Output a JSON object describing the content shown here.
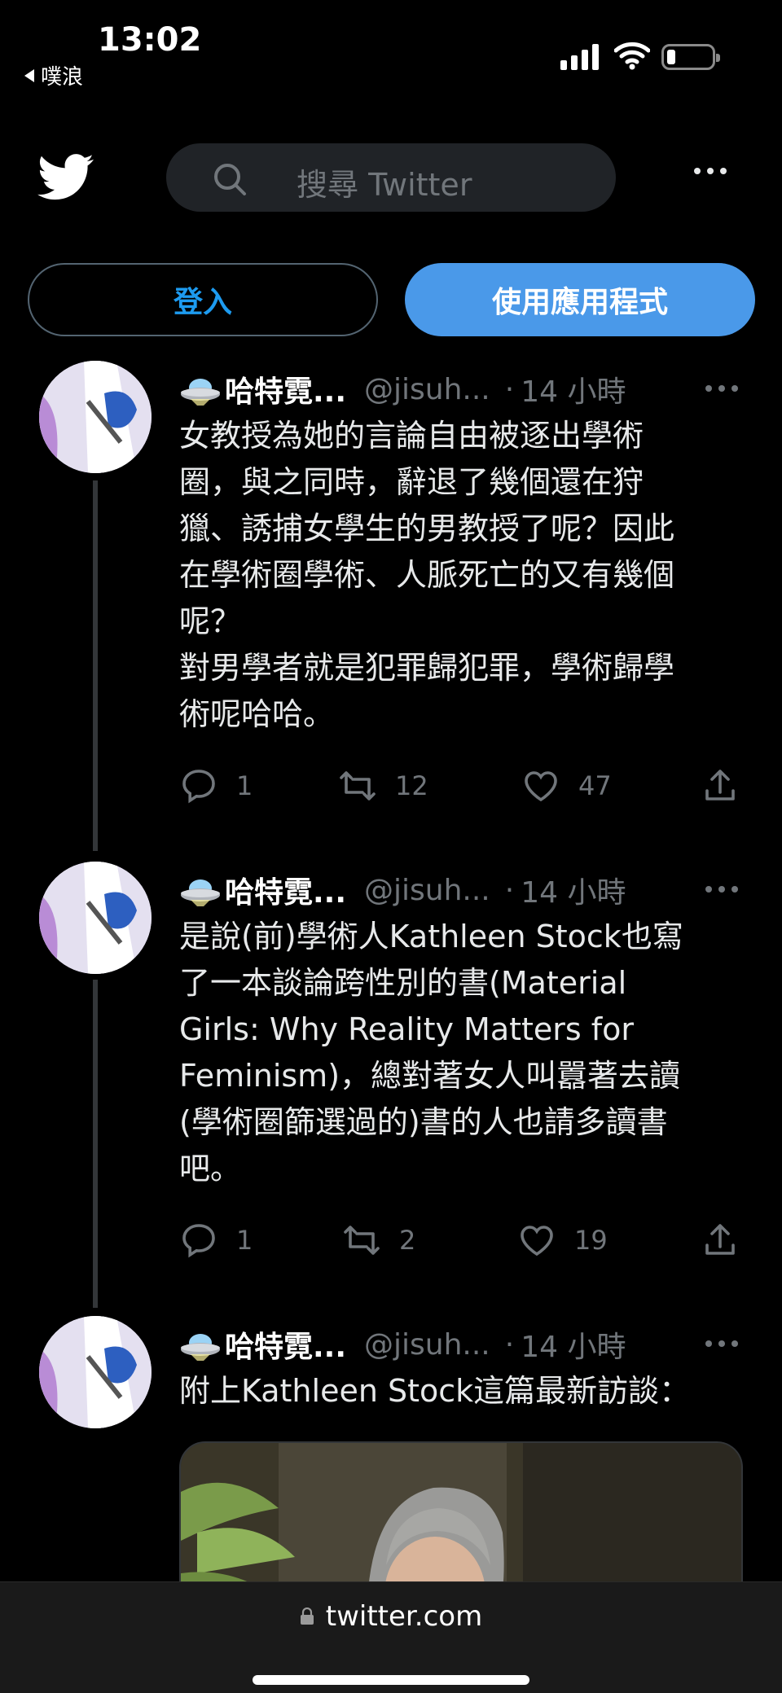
{
  "status_bar": {
    "time": "13:02",
    "back_app": "噗浪"
  },
  "header": {
    "search_placeholder": "搜尋 Twitter"
  },
  "auth": {
    "login_label": "登入",
    "use_app_label": "使用應用程式"
  },
  "tweets": [
    {
      "name": "哈特霓...",
      "handle": "@jisuh...",
      "separator": "·",
      "time": "14 小時",
      "text": "女教授為她的言論自由被逐出學術\n圈，與之同時，辭退了幾個還在狩\n獵、誘捕女學生的男教授了呢？因此\n在學術圈學術、人脈死亡的又有幾個\n呢？\n對男學者就是犯罪歸犯罪，學術歸學\n術呢哈哈。",
      "replies": "1",
      "retweets": "12",
      "likes": "47"
    },
    {
      "name": "哈特霓...",
      "handle": "@jisuh...",
      "separator": "·",
      "time": "14 小時",
      "text": "是說(前)學術人Kathleen Stock也寫\n了一本談論跨性別的書(Material\nGirls: Why Reality Matters for\nFeminism)，總對著女人叫囂著去讀\n(學術圈篩選過的)書的人也請多讀書\n吧。",
      "replies": "1",
      "retweets": "2",
      "likes": "19"
    },
    {
      "name": "哈特霓...",
      "handle": "@jisuh...",
      "separator": "·",
      "time": "14 小時",
      "text": "附上Kathleen Stock這篇最新訪談："
    }
  ],
  "browser": {
    "url": "twitter.com"
  },
  "colors": {
    "accent": "#1d9bf0",
    "app_button": "#4a99e9",
    "muted": "#71767b"
  }
}
